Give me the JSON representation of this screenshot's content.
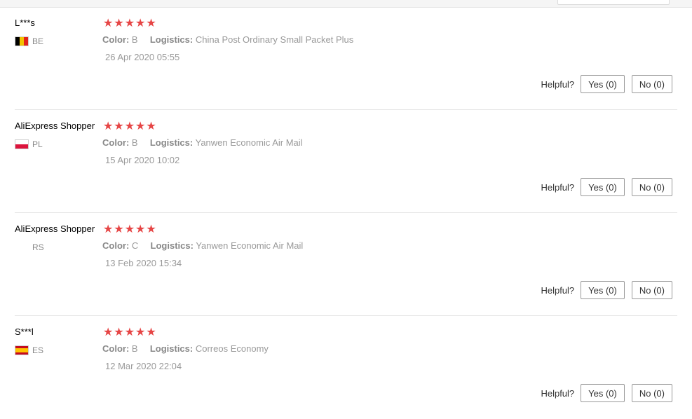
{
  "reviews": [
    {
      "name": "L***s",
      "country": "BE",
      "flag_colors": [
        "#000000",
        "#f2c200",
        "#e2231a"
      ],
      "flag_orientation": "vertical",
      "stars": "★★★★★",
      "color_label": "Color:",
      "color_value": "B",
      "logistics_label": "Logistics:",
      "logistics_value": "China Post Ordinary Small Packet Plus",
      "date": "26 Apr 2020 05:55",
      "helpful_label": "Helpful?",
      "yes_label": "Yes (0)",
      "no_label": "No (0)"
    },
    {
      "name": "AliExpress Shopper",
      "country": "PL",
      "flag_colors": [
        "#ffffff",
        "#dc143c"
      ],
      "flag_orientation": "horizontal",
      "stars": "★★★★★",
      "color_label": "Color:",
      "color_value": "B",
      "logistics_label": "Logistics:",
      "logistics_value": "Yanwen Economic Air Mail",
      "date": "15 Apr 2020 10:02",
      "helpful_label": "Helpful?",
      "yes_label": "Yes (0)",
      "no_label": "No (0)"
    },
    {
      "name": "AliExpress Shopper",
      "country": "RS",
      "flag_colors": [],
      "flag_orientation": "none",
      "stars": "★★★★★",
      "color_label": "Color:",
      "color_value": "C",
      "logistics_label": "Logistics:",
      "logistics_value": "Yanwen Economic Air Mail",
      "date": "13 Feb 2020 15:34",
      "helpful_label": "Helpful?",
      "yes_label": "Yes (0)",
      "no_label": "No (0)"
    },
    {
      "name": "S***l",
      "country": "ES",
      "flag_colors": [
        "#c60b1e",
        "#ffc400",
        "#c60b1e"
      ],
      "flag_orientation": "spain",
      "stars": "★★★★★",
      "color_label": "Color:",
      "color_value": "B",
      "logistics_label": "Logistics:",
      "logistics_value": "Correos Economy",
      "date": "12 Mar 2020 22:04",
      "helpful_label": "Helpful?",
      "yes_label": "Yes (0)",
      "no_label": "No (0)"
    }
  ],
  "colors": {
    "star": "#e64545",
    "muted_text": "#999999",
    "divider": "#e5e5e5"
  }
}
